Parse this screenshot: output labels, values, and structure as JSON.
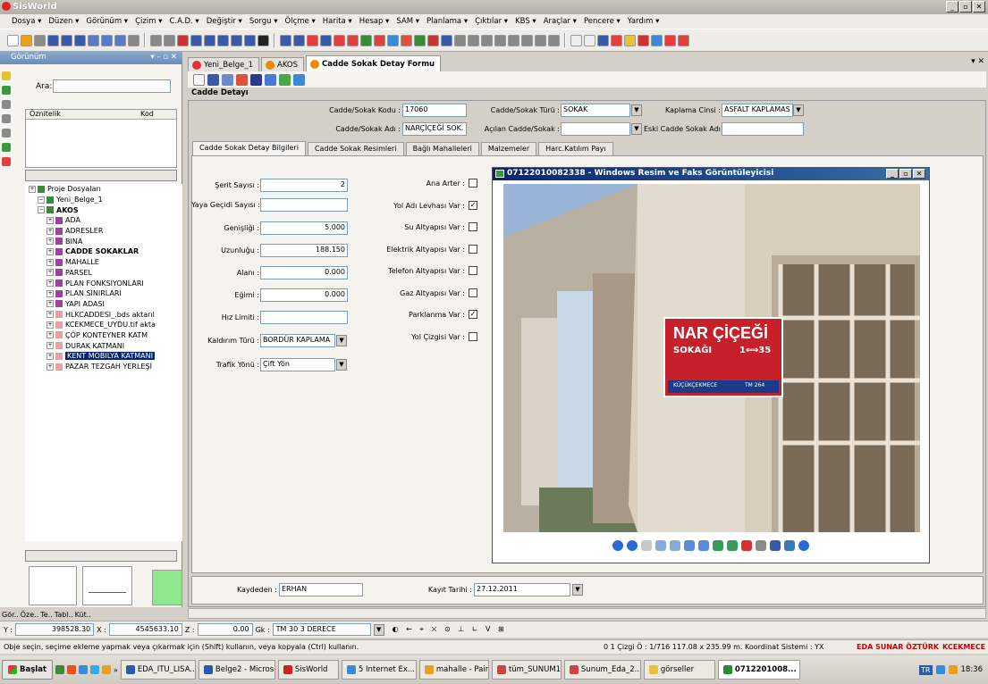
{
  "app": {
    "title": "SisWorld"
  },
  "menu": [
    "Dosya ▾",
    "Düzen ▾",
    "Görünüm ▾",
    "Çizim ▾",
    "C.A.D. ▾",
    "Değiştir ▾",
    "Sorgu ▾",
    "Ölçme ▾",
    "Harita ▾",
    "Hesap ▾",
    "SAM ▾",
    "Planlama ▾",
    "Çıktılar ▾",
    "KBS ▾",
    "Araçlar ▾",
    "Pencere ▾",
    "Yardım ▾"
  ],
  "left_panel": {
    "title": "Görünüm",
    "search_label": "Ara:",
    "attr_headers": {
      "name": "Öznitelik",
      "code": "Kod"
    },
    "tree": [
      {
        "label": "Proje Dosyaları",
        "indent": 0
      },
      {
        "label": "Yeni_Belge_1",
        "indent": 1
      },
      {
        "label": "AKOS",
        "indent": 1,
        "bold": true
      },
      {
        "label": "ADA",
        "indent": 2
      },
      {
        "label": "ADRESLER",
        "indent": 2
      },
      {
        "label": "BINA",
        "indent": 2
      },
      {
        "label": "CADDE SOKAKLAR",
        "indent": 2,
        "bold": true
      },
      {
        "label": "MAHALLE",
        "indent": 2
      },
      {
        "label": "PARSEL",
        "indent": 2
      },
      {
        "label": "PLAN FONKSIYONLARI",
        "indent": 2
      },
      {
        "label": "PLAN SINIRLARI",
        "indent": 2
      },
      {
        "label": "YAPI ADASI",
        "indent": 2
      },
      {
        "label": "HLKCADDESI_.bds aktarıl",
        "indent": 2
      },
      {
        "label": "KCEKMECE_UYDU.tif akta",
        "indent": 2
      },
      {
        "label": "ÇÖP KONTEYNER KATM",
        "indent": 2
      },
      {
        "label": "DURAK KATMANI",
        "indent": 2
      },
      {
        "label": "KENT MOBILYA KATMANI",
        "indent": 2,
        "selected": true
      },
      {
        "label": "PAZAR TEZGAH YERLEŞİ",
        "indent": 2
      }
    ],
    "bottom_tabs": [
      "Gör..",
      "Öze..",
      "Te..",
      "Tabl..",
      "Küt.."
    ]
  },
  "doc_tabs": [
    {
      "label": "Yeni_Belge_1",
      "color": "#d33"
    },
    {
      "label": "AKOS",
      "color": "#e80"
    },
    {
      "label": "Cadde Sokak Detay Formu",
      "color": "#e80",
      "active": true
    }
  ],
  "form": {
    "title": "Cadde Detayı",
    "kod_label": "Cadde/Sokak Kodu :",
    "kod_value": "17060",
    "ad_label": "Cadde/Sokak Adı :",
    "ad_value": "NARÇİÇEĞİ SOK.",
    "tur_label": "Cadde/Sokak Türü :",
    "tur_value": "SOKAK",
    "acilan_label": "Açılan Cadde/Sokak :",
    "acilan_value": "",
    "kaplama_label": "Kaplama Cinsi :",
    "kaplama_value": "ASFALT KAPLAMAS",
    "eski_label": "Eski Cadde Sokak Adı :",
    "eski_value": ""
  },
  "sub_tabs": [
    "Cadde Sokak Detay Bilgileri",
    "Cadde Sokak Resimleri",
    "Bağlı Mahalleleri",
    "Malzemeler",
    "Harc.Katılım Payı"
  ],
  "details": {
    "serit_label": "Şerit Sayısı :",
    "serit_value": "2",
    "yaya_label": "Yaya Geçidi Sayısı :",
    "yaya_value": "",
    "genislik_label": "Genişliği :",
    "genislik_value": "5.000",
    "uzunluk_label": "Uzunluğu :",
    "uzunluk_value": "188.150",
    "alan_label": "Alanı :",
    "alan_value": "0.000",
    "egim_label": "Eğimi :",
    "egim_value": "0.000",
    "hiz_label": "Hız Limiti :",
    "hiz_value": "",
    "kaldirim_label": "Kaldırım Türü :",
    "kaldirim_value": "BORDÜR KAPLAMA",
    "trafik_label": "Trafik Yönü :",
    "trafik_value": "Çift Yön"
  },
  "checks": [
    {
      "label": "Ana Arter :",
      "checked": false
    },
    {
      "label": "Yol Adı Levhası Var :",
      "checked": true
    },
    {
      "label": "Su Altyapısı Var :",
      "checked": false
    },
    {
      "label": "Elektrik Altyapısı Var :",
      "checked": false
    },
    {
      "label": "Telefon Altyapısı Var :",
      "checked": false
    },
    {
      "label": "Gaz Altyapısı Var :",
      "checked": false
    },
    {
      "label": "Parklanma Var :",
      "checked": true
    },
    {
      "label": "Yol Çizgisi Var :",
      "checked": false
    }
  ],
  "viewer": {
    "title": "07122010082338 - Windows Resim ve Faks Görüntüleyicisi",
    "sign_main": "NAR ÇİÇEĞİ",
    "sign_sub": "SOKAĞI",
    "sign_num": "1⟺35",
    "sign_district": "KÜÇÜKÇEKMECE",
    "sign_code": "TM 264"
  },
  "footer": {
    "kaydeden_label": "Kaydeden :",
    "kaydeden_value": "ERHAN",
    "tarih_label": "Kayıt Tarihi :",
    "tarih_value": "27.12.2011"
  },
  "coords": {
    "y_label": "Y :",
    "y_value": "398528.30",
    "x_label": "X :",
    "x_value": "4545633.10",
    "z_label": "Z :",
    "z_value": "0.00",
    "gk_label": "Gk :",
    "gk_value": "TM 30 3 DERECE"
  },
  "status": {
    "message": "Obje seçin, seçime ekleme yapmak veya çıkarmak için (Shift) kullanın, veya kopyala (Ctrl) kullanın.",
    "counts": "0 1 Çizgi Ö : 1/716 117.08 x 235.99 m. Koordinat Sistemi : YX",
    "user": "EDA SUNAR ÖZTÜRK",
    "org": "KCEKMECE"
  },
  "taskbar": {
    "start": "Başlat",
    "items": [
      {
        "label": "EDA_ITU_LISA...",
        "color": "#2a5ab0"
      },
      {
        "label": "Belge2 - Micros...",
        "color": "#2a5ab0"
      },
      {
        "label": "SisWorld",
        "color": "#c22"
      },
      {
        "label": "5 Internet Ex...",
        "color": "#3a8ad8"
      },
      {
        "label": "mahalle - Paint",
        "color": "#e8a020"
      },
      {
        "label": "tüm_SUNUM17...",
        "color": "#c44"
      },
      {
        "label": "Sunum_Eda_2...",
        "color": "#c44"
      },
      {
        "label": "görseller",
        "color": "#e8c040"
      },
      {
        "label": "0712201008...",
        "color": "#2a8a3a",
        "active": true
      }
    ],
    "lang": "TR",
    "clock": "18:36"
  }
}
